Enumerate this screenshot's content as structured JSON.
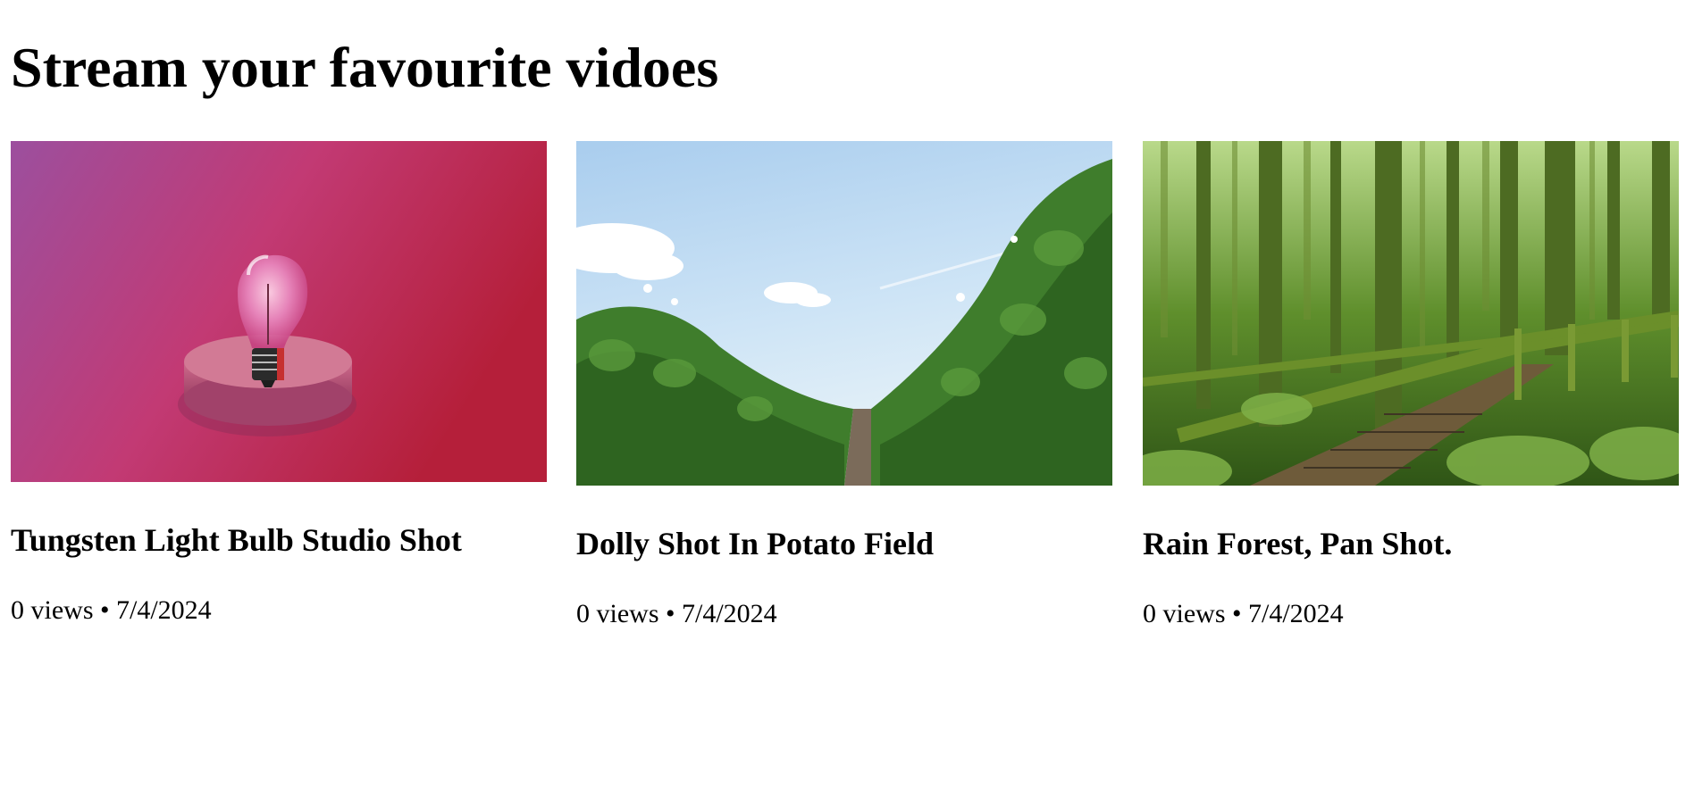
{
  "page": {
    "title": "Stream your favourite vidoes"
  },
  "videos": [
    {
      "title": "Tungsten Light Bulb Studio Shot",
      "views": "0 views",
      "separator": "•",
      "date": "7/4/2024",
      "meta": "0 views • 7/4/2024",
      "thumbnail": "light-bulb-on-pink-pedestal"
    },
    {
      "title": "Dolly Shot In Potato Field",
      "views": "0 views",
      "separator": "•",
      "date": "7/4/2024",
      "meta": "0 views • 7/4/2024",
      "thumbnail": "potato-field-under-blue-sky"
    },
    {
      "title": "Rain Forest, Pan Shot.",
      "views": "0 views",
      "separator": "•",
      "date": "7/4/2024",
      "meta": "0 views • 7/4/2024",
      "thumbnail": "mossy-rainforest-boardwalk"
    }
  ],
  "colors": {
    "text": "#000000",
    "background": "#ffffff"
  }
}
